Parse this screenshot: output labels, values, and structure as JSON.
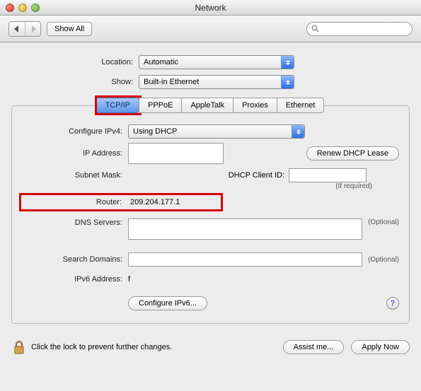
{
  "window": {
    "title": "Network"
  },
  "toolbar": {
    "show_all_label": "Show All",
    "search_placeholder": ""
  },
  "location": {
    "label": "Location:",
    "value": "Automatic"
  },
  "show": {
    "label": "Show:",
    "value": "Built-in Ethernet"
  },
  "tabs": {
    "items": [
      {
        "label": "TCP/IP",
        "active": true,
        "highlighted": true
      },
      {
        "label": "PPPoE"
      },
      {
        "label": "AppleTalk"
      },
      {
        "label": "Proxies"
      },
      {
        "label": "Ethernet"
      }
    ]
  },
  "tcpip": {
    "configure_ipv4_label": "Configure IPv4:",
    "configure_ipv4_value": "Using DHCP",
    "ip_address_label": "IP Address:",
    "ip_address_value": "",
    "renew_lease_label": "Renew DHCP Lease",
    "subnet_mask_label": "Subnet Mask:",
    "subnet_mask_value": "",
    "dhcp_client_label": "DHCP Client ID:",
    "dhcp_client_value": "",
    "dhcp_client_hint": "(If required)",
    "router_label": "Router:",
    "router_value": "209.204.177.1",
    "dns_label": "DNS Servers:",
    "dns_value": "",
    "optional": "(Optional)",
    "search_domains_label": "Search Domains:",
    "search_domains_value": "",
    "ipv6_address_label": "IPv6 Address:",
    "ipv6_address_value": "f",
    "configure_ipv6_label": "Configure IPv6..."
  },
  "footer": {
    "lock_text": "Click the lock to prevent further changes.",
    "assist_label": "Assist me...",
    "apply_label": "Apply Now"
  },
  "help_char": "?"
}
